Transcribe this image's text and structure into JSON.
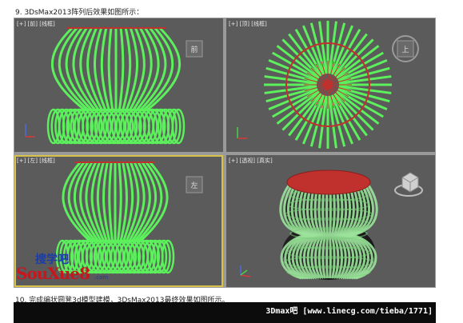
{
  "captions": {
    "step9": "9. 3DsMax2013阵列后效果如图所示：",
    "step10": "10. 完成编状圆凳3d模型建模，3DsMax2013最终效果如图所示。"
  },
  "viewports": {
    "front": {
      "label": "[+] [前] [线框]",
      "cube_face": "前"
    },
    "top": {
      "label": "[+] [顶] [线框]",
      "cube_face": "上"
    },
    "left": {
      "label": "[+] [左] [线框]",
      "cube_face": "左"
    },
    "perspective": {
      "label": "[+] [透视] [真实]"
    }
  },
  "watermark": {
    "logo_cn": "搜学吧",
    "logo_en": "SouXue8",
    "logo_com": ".com",
    "bottom": "3Dmax吧 [www.linecg.com/tieba/1771]"
  },
  "colors": {
    "wire": "#5cf05c",
    "seat": "#c0302c",
    "viewport_bg": "#5b5b5b",
    "active_border": "#d9c24a"
  }
}
